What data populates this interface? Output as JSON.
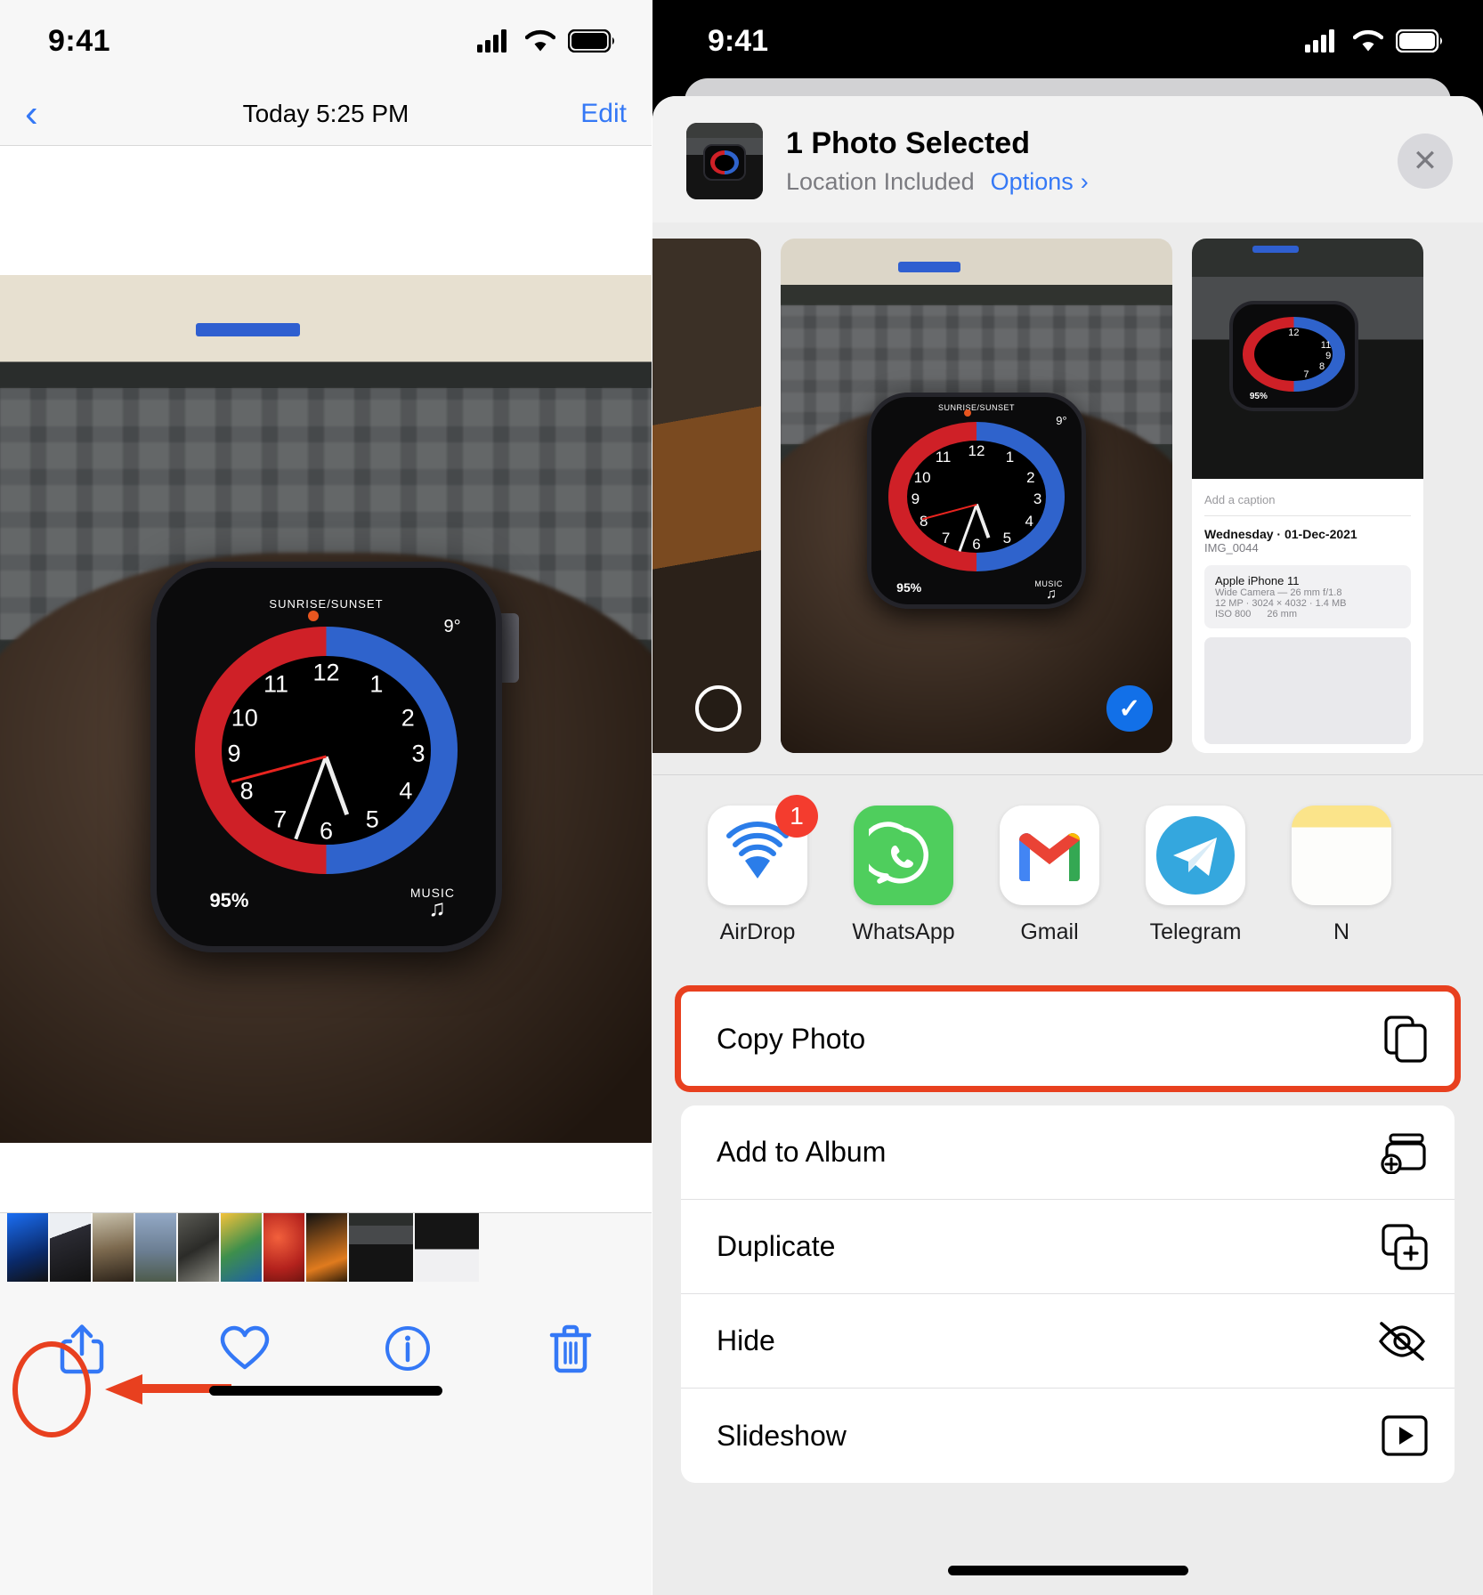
{
  "left": {
    "status": {
      "time": "9:41",
      "cellular": "signal-bars",
      "wifi": "wifi-icon",
      "battery": "battery-full"
    },
    "nav": {
      "back": "‹",
      "title": "Today  5:25 PM",
      "edit": "Edit"
    },
    "toolbar": {
      "share": "share-icon",
      "favorite": "heart-icon",
      "info": "info-icon",
      "delete": "trash-icon"
    },
    "annotation": {
      "highlight": "share-button-highlight",
      "arrow": "red-arrow-pointing-left"
    },
    "filmstrip_count": 9
  },
  "right": {
    "status": {
      "time": "9:41",
      "cellular": "signal-bars",
      "wifi": "wifi-icon",
      "battery": "battery-full"
    },
    "sheet_header": {
      "title": "1 Photo Selected",
      "subtitle": "Location Included",
      "options_label": "Options",
      "options_chevron": "›",
      "close": "✕"
    },
    "previews": [
      {
        "name": "preview-prev",
        "selected": false,
        "check": ""
      },
      {
        "name": "preview-current",
        "selected": true,
        "check": "✓"
      },
      {
        "name": "preview-next-metadata",
        "selected": false,
        "check": ""
      }
    ],
    "metadata_card": {
      "caption_placeholder": "Add a caption",
      "date": "Wednesday · 01-Dec-2021",
      "filename": "IMG_0044",
      "device": "Apple iPhone 11",
      "lens": "Wide Camera — 26 mm f/1.8",
      "resolution": "12 MP · 3024 × 4032 · 1.4 MB",
      "iso": "ISO 800",
      "focal": "26 mm"
    },
    "apps": [
      {
        "label": "AirDrop",
        "icon": "airdrop-icon",
        "badge": "1"
      },
      {
        "label": "WhatsApp",
        "icon": "whatsapp-icon",
        "badge": ""
      },
      {
        "label": "Gmail",
        "icon": "gmail-icon",
        "badge": ""
      },
      {
        "label": "Telegram",
        "icon": "telegram-icon",
        "badge": ""
      },
      {
        "label": "N",
        "icon": "notes-icon",
        "badge": ""
      }
    ],
    "actions_highlighted": [
      {
        "label": "Copy Photo",
        "icon": "copy-icon"
      }
    ],
    "actions": [
      {
        "label": "Add to Album",
        "icon": "add-to-album-icon"
      },
      {
        "label": "Duplicate",
        "icon": "duplicate-icon"
      },
      {
        "label": "Hide",
        "icon": "hide-eye-slash-icon"
      },
      {
        "label": "Slideshow",
        "icon": "slideshow-play-icon"
      }
    ],
    "colors": {
      "accent": "#3478f6",
      "highlight": "#e8401f",
      "selected_check": "#1270e8"
    }
  }
}
